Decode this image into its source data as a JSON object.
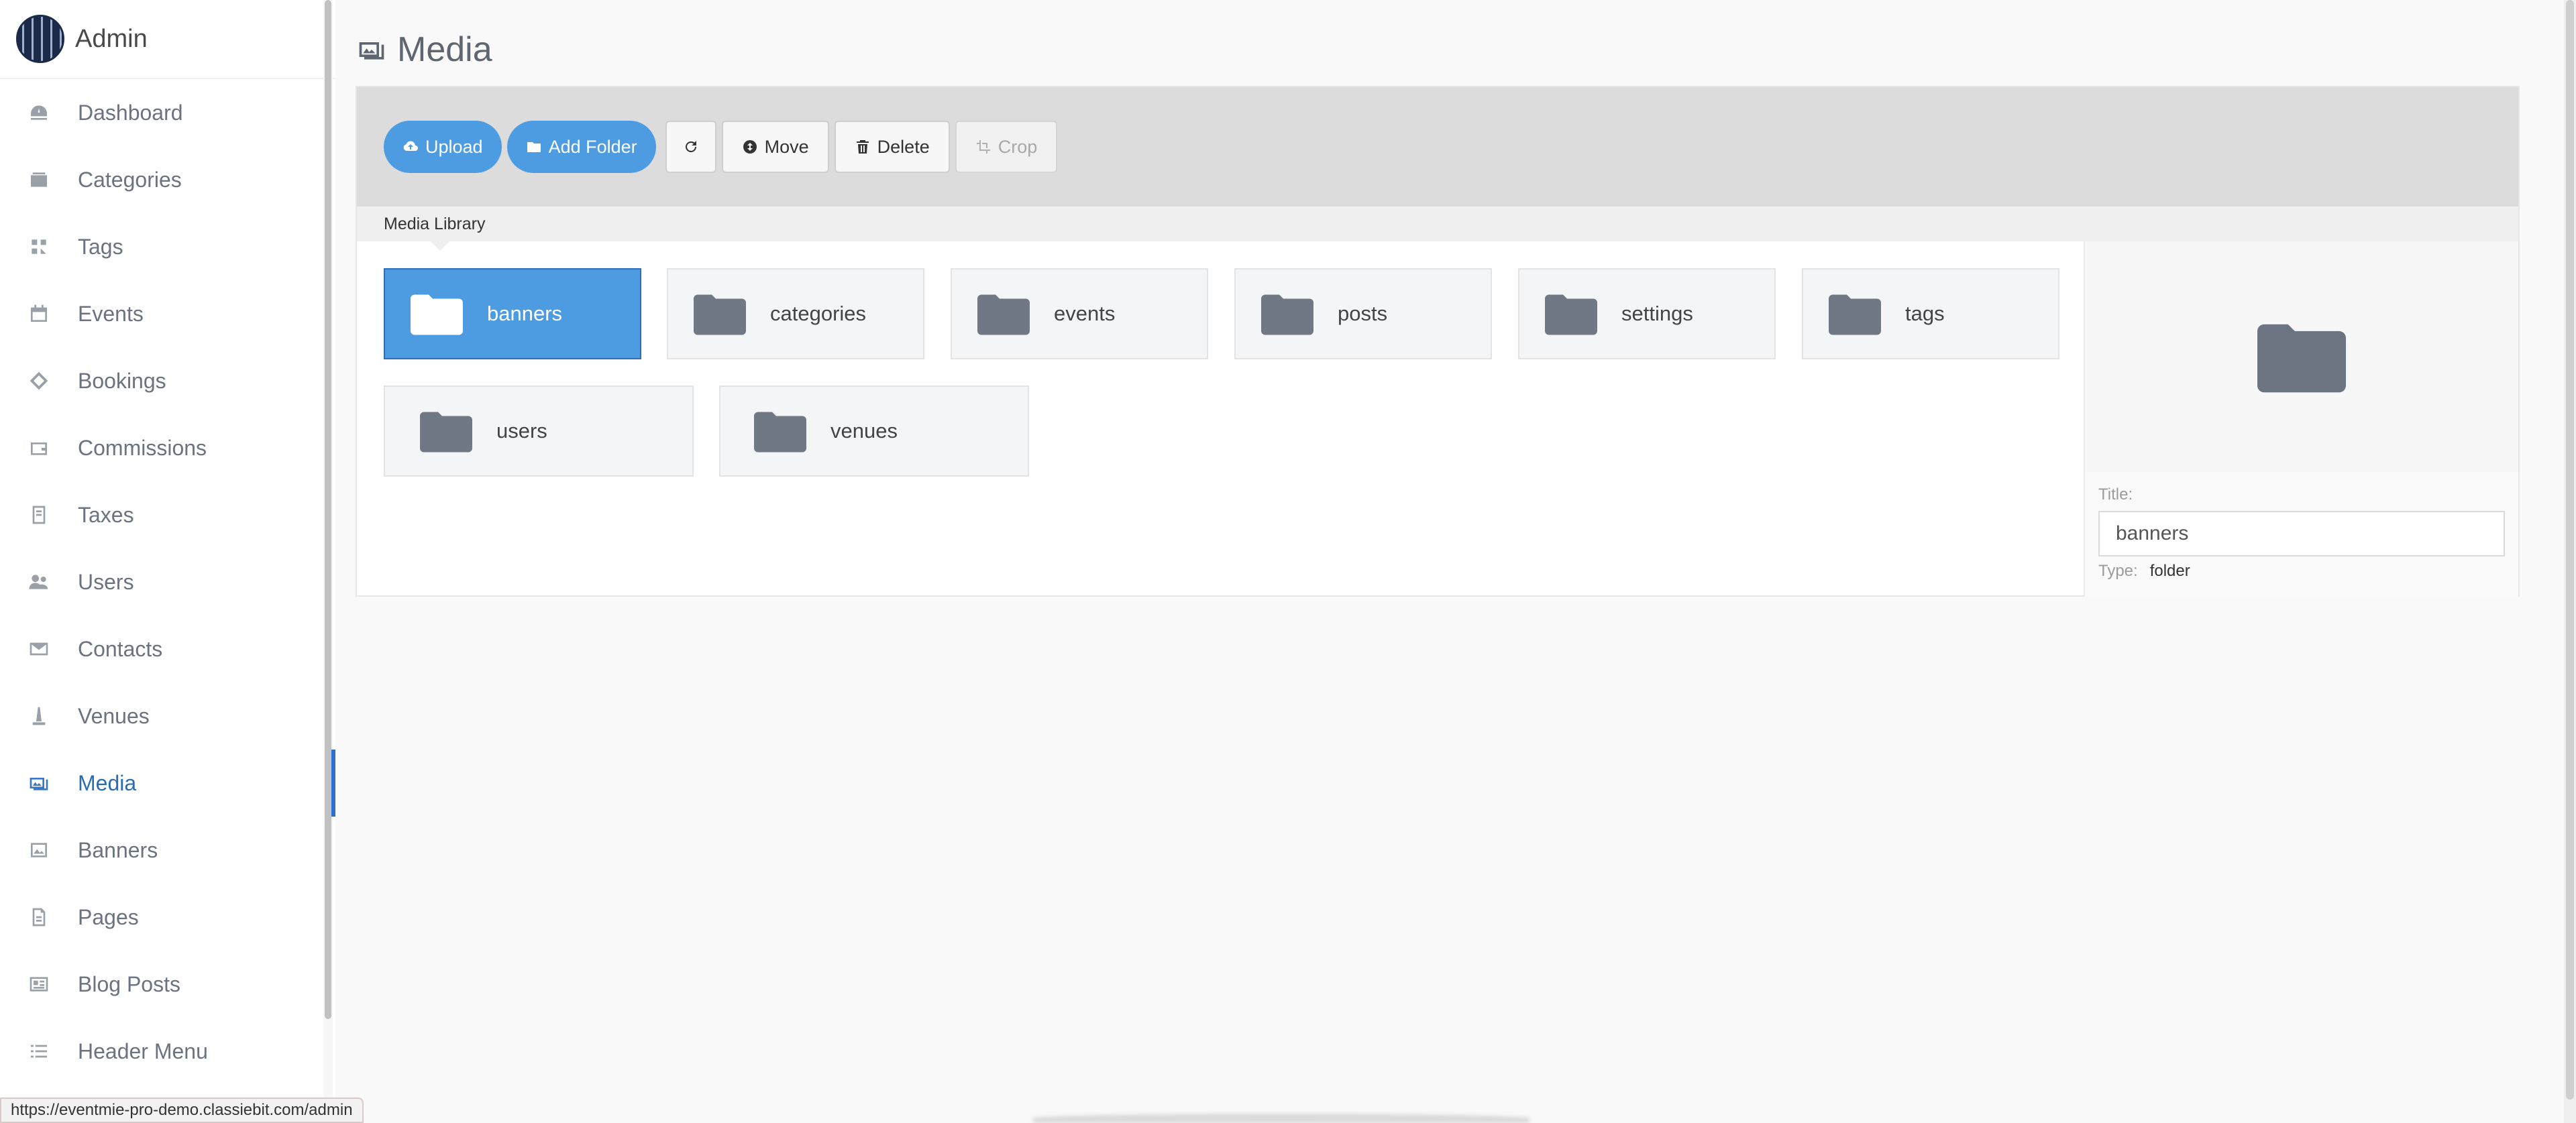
{
  "sidebar": {
    "brand": "Admin",
    "items": [
      {
        "label": "Dashboard",
        "icon": "dashboard-icon"
      },
      {
        "label": "Categories",
        "icon": "categories-icon"
      },
      {
        "label": "Tags",
        "icon": "tags-icon"
      },
      {
        "label": "Events",
        "icon": "calendar-icon"
      },
      {
        "label": "Bookings",
        "icon": "ticket-icon"
      },
      {
        "label": "Commissions",
        "icon": "wallet-icon"
      },
      {
        "label": "Taxes",
        "icon": "receipt-icon"
      },
      {
        "label": "Users",
        "icon": "users-icon"
      },
      {
        "label": "Contacts",
        "icon": "mail-icon"
      },
      {
        "label": "Venues",
        "icon": "venue-icon"
      },
      {
        "label": "Media",
        "icon": "media-icon",
        "active": true
      },
      {
        "label": "Banners",
        "icon": "banner-icon"
      },
      {
        "label": "Pages",
        "icon": "page-icon"
      },
      {
        "label": "Blog Posts",
        "icon": "blog-icon"
      },
      {
        "label": "Header Menu",
        "icon": "list-icon"
      }
    ]
  },
  "header": {
    "title": "Media"
  },
  "toolbar": {
    "upload": "Upload",
    "add_folder": "Add Folder",
    "move": "Move",
    "delete": "Delete",
    "crop": "Crop"
  },
  "library": {
    "label": "Media Library",
    "folders": [
      "banners",
      "categories",
      "events",
      "posts",
      "settings",
      "tags",
      "users",
      "venues"
    ],
    "selected": "banners"
  },
  "details": {
    "title_label": "Title:",
    "title_value": "banners",
    "type_label": "Type:",
    "type_value": "folder"
  },
  "status_url": "https://eventmie-pro-demo.classiebit.com/admin",
  "colors": {
    "accent": "#4d9be0",
    "active_nav": "#2b6cb0"
  }
}
